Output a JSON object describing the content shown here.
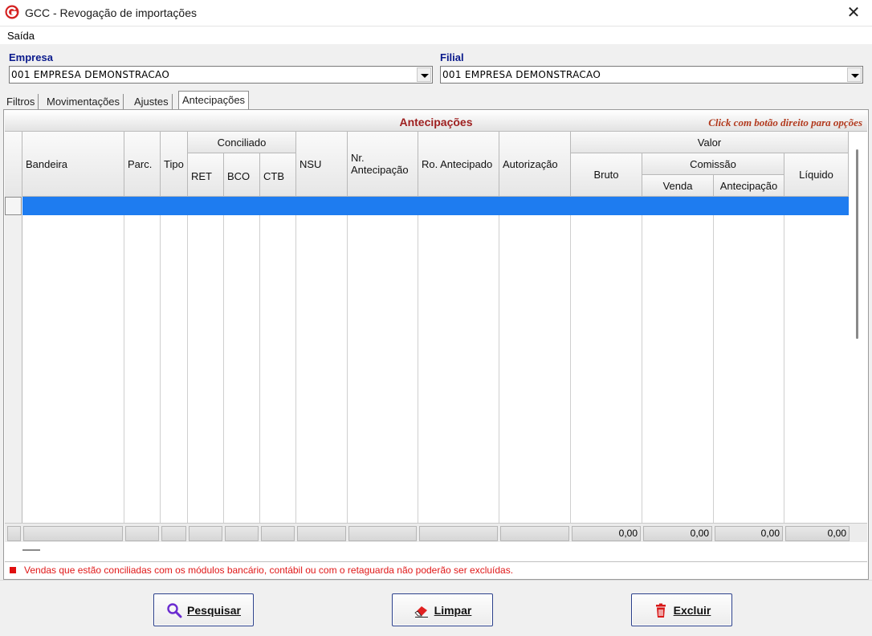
{
  "window": {
    "title": "GCC - Revogação de importações"
  },
  "menu": {
    "items": [
      {
        "label": "Saída"
      }
    ]
  },
  "filters": {
    "empresa": {
      "label": "Empresa",
      "value": "001 EMPRESA DEMONSTRACAO"
    },
    "filial": {
      "label": "Filial",
      "value": "001 EMPRESA DEMONSTRACAO"
    }
  },
  "tabs": [
    {
      "label": "Filtros",
      "active": false
    },
    {
      "label": "Movimentações",
      "active": false
    },
    {
      "label": "Ajustes",
      "active": false
    },
    {
      "label": "Antecipações",
      "active": true
    }
  ],
  "grid": {
    "title": "Antecipações",
    "hint": "Click com botão direito para opções",
    "headers": {
      "bandeira": "Bandeira",
      "parc": "Parc.",
      "tipo": "Tipo",
      "conciliado": "Conciliado",
      "ret": "RET",
      "bco": "BCO",
      "ctb": "CTB",
      "nsu": "NSU",
      "nr_antecipacao": "Nr. Antecipação",
      "ro_antecipado": "Ro. Antecipado",
      "autorizacao": "Autorização",
      "valor": "Valor",
      "bruto": "Bruto",
      "comissao": "Comissão",
      "venda": "Venda",
      "antecipacao": "Antecipação",
      "liquido": "Líquido"
    },
    "totals": {
      "bruto": "0,00",
      "venda": "0,00",
      "antecipacao": "0,00",
      "liquido": "0,00"
    }
  },
  "notice": "Vendas que estão conciliadas com os módulos bancário, contábil ou com o retaguarda não poderão ser excluídas.",
  "buttons": {
    "pesquisar": "Pesquisar",
    "limpar": "Limpar",
    "excluir": "Excluir"
  },
  "colors": {
    "label_blue": "#0a1a8c",
    "selection_blue": "#1e7cf0",
    "grid_title_red": "#9e2020",
    "notice_red": "#e01818"
  }
}
